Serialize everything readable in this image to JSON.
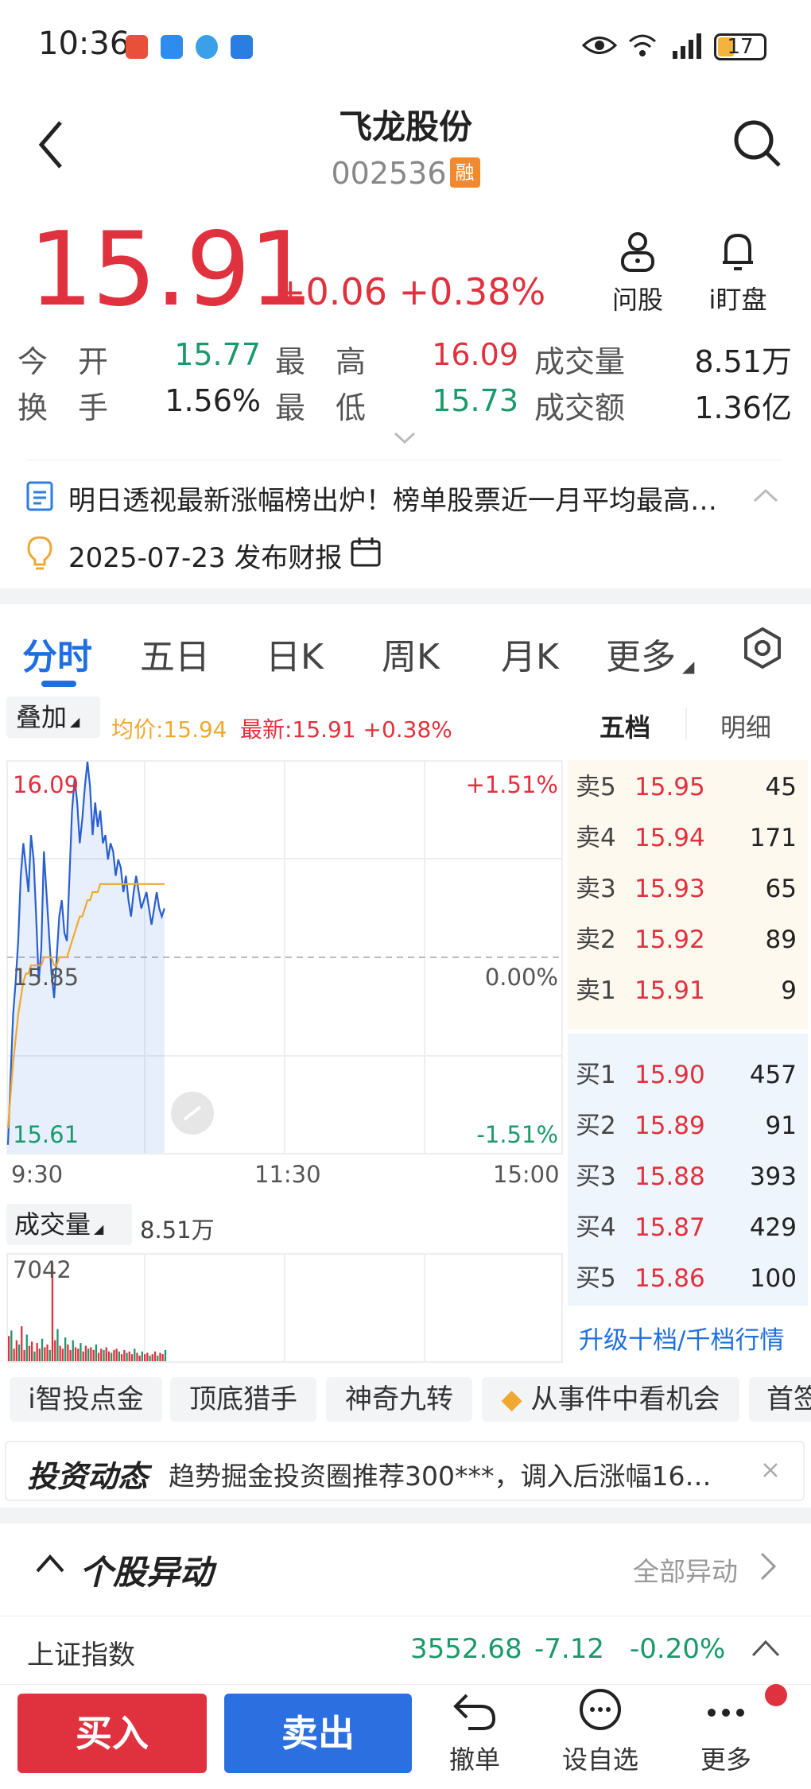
{
  "status_bar": {
    "time": "10:36",
    "battery": "17"
  },
  "header": {
    "title": "飞龙股份",
    "code": "002536",
    "badge": "融"
  },
  "quote": {
    "price": "15.91",
    "change": "+0.06",
    "change_pct": "+0.38%",
    "ask_label": "问股",
    "watch_label": "i盯盘",
    "open_label": "今　开",
    "open": "15.77",
    "high_label": "最　高",
    "high": "16.09",
    "volume_label": "成交量",
    "volume": "8.51万",
    "turnover_label": "换　手",
    "turnover": "1.56%",
    "low_label": "最　低",
    "low": "15.73",
    "amount_label": "成交额",
    "amount": "1.36亿"
  },
  "news": {
    "headline": "明日透视最新涨幅榜出炉！榜单股票近一月平均最高…",
    "report": "2025-07-23 发布财报"
  },
  "tabs": [
    "分时",
    "五日",
    "日K",
    "周K",
    "月K",
    "更多"
  ],
  "chart_toolbar": {
    "overlay": "叠加",
    "avg_label": "均价:15.94",
    "latest_label": "最新:15.91 +0.38%",
    "tab_five": "五档",
    "tab_detail": "明细"
  },
  "chart_data": {
    "type": "line",
    "title": "",
    "price_high_label": "16.09",
    "price_mid_label": "15.85",
    "price_low_label": "15.61",
    "pct_high_label": "+1.51%",
    "pct_mid_label": "0.00%",
    "pct_low_label": "-1.51%",
    "x_ticks": [
      "9:30",
      "11:30",
      "15:00"
    ],
    "ylim": [
      15.61,
      16.09
    ],
    "series": [
      {
        "values": [
          15.62,
          15.7,
          15.78,
          15.82,
          15.87,
          15.95,
          15.99,
          15.96,
          15.93,
          16.0,
          15.97,
          15.9,
          15.82,
          15.86,
          15.98,
          15.93,
          15.88,
          15.83,
          15.8,
          15.85,
          15.9,
          15.92,
          15.88,
          15.87,
          15.95,
          16.03,
          16.07,
          16.04,
          15.99,
          16.02,
          16.06,
          16.09,
          16.06,
          16.0,
          16.04,
          16.01,
          16.03,
          15.99,
          16.0,
          15.97,
          15.99,
          15.98,
          15.95,
          15.97,
          15.96,
          15.93,
          15.95,
          15.92,
          15.9,
          15.93,
          15.95,
          15.93,
          15.91,
          15.92,
          15.93,
          15.91,
          15.89,
          15.91,
          15.93,
          15.91,
          15.9,
          15.91
        ]
      },
      {
        "values": [
          15.64,
          15.68,
          15.72,
          15.75,
          15.78,
          15.8,
          15.82,
          15.83,
          15.83,
          15.84,
          15.84,
          15.84,
          15.84,
          15.84,
          15.85,
          15.85,
          15.85,
          15.85,
          15.84,
          15.84,
          15.85,
          15.85,
          15.85,
          15.85,
          15.86,
          15.87,
          15.88,
          15.89,
          15.9,
          15.9,
          15.91,
          15.92,
          15.92,
          15.93,
          15.93,
          15.93,
          15.94,
          15.94,
          15.94,
          15.94,
          15.94,
          15.94,
          15.94,
          15.94,
          15.94,
          15.94,
          15.94,
          15.94,
          15.94,
          15.94,
          15.94,
          15.94,
          15.94,
          15.94,
          15.94,
          15.94,
          15.94,
          15.94,
          15.94,
          15.94,
          15.94,
          15.94
        ]
      }
    ],
    "volume_label": "成交量",
    "volume_total": "8.51万",
    "volume_max_label": "7042",
    "volume_bars": [
      1800,
      2200,
      900,
      1500,
      1200,
      2500,
      800,
      1900,
      1100,
      1400,
      700,
      1300,
      900,
      1600,
      1000,
      1200,
      800,
      7042,
      1500,
      2300,
      1100,
      900,
      1700,
      1200,
      800,
      1500,
      1000,
      900,
      1300,
      700,
      1100,
      900,
      1000,
      800,
      1200,
      600,
      900,
      800,
      1000,
      700,
      600,
      800,
      900,
      700,
      500,
      800,
      600,
      700,
      500,
      900,
      600,
      400,
      700,
      500,
      600,
      400,
      500,
      700,
      400,
      600,
      500,
      800
    ]
  },
  "order_book": {
    "sell": [
      {
        "label": "卖5",
        "price": "15.95",
        "vol": "45"
      },
      {
        "label": "卖4",
        "price": "15.94",
        "vol": "171"
      },
      {
        "label": "卖3",
        "price": "15.93",
        "vol": "65"
      },
      {
        "label": "卖2",
        "price": "15.92",
        "vol": "89"
      },
      {
        "label": "卖1",
        "price": "15.91",
        "vol": "9"
      }
    ],
    "buy": [
      {
        "label": "买1",
        "price": "15.90",
        "vol": "457"
      },
      {
        "label": "买2",
        "price": "15.89",
        "vol": "91"
      },
      {
        "label": "买3",
        "price": "15.88",
        "vol": "393"
      },
      {
        "label": "买4",
        "price": "15.87",
        "vol": "429"
      },
      {
        "label": "买5",
        "price": "15.86",
        "vol": "100"
      }
    ],
    "upgrade": "升级十档/千档行情"
  },
  "chips": [
    "i智投点金",
    "顶底猎手",
    "神奇九转",
    "从事件中看机会",
    "首签"
  ],
  "banner": {
    "logo": "投资动态",
    "text": "趋势掘金投资圈推荐300***，调入后涨幅16…"
  },
  "abnormal": {
    "title": "个股异动",
    "all": "全部异动"
  },
  "index": {
    "name": "上证指数",
    "value": "3552.68",
    "change": "-7.12",
    "pct": "-0.20%"
  },
  "footer": {
    "buy": "买入",
    "sell": "卖出",
    "cancel": "撤单",
    "watchlist": "设自选",
    "more": "更多"
  }
}
